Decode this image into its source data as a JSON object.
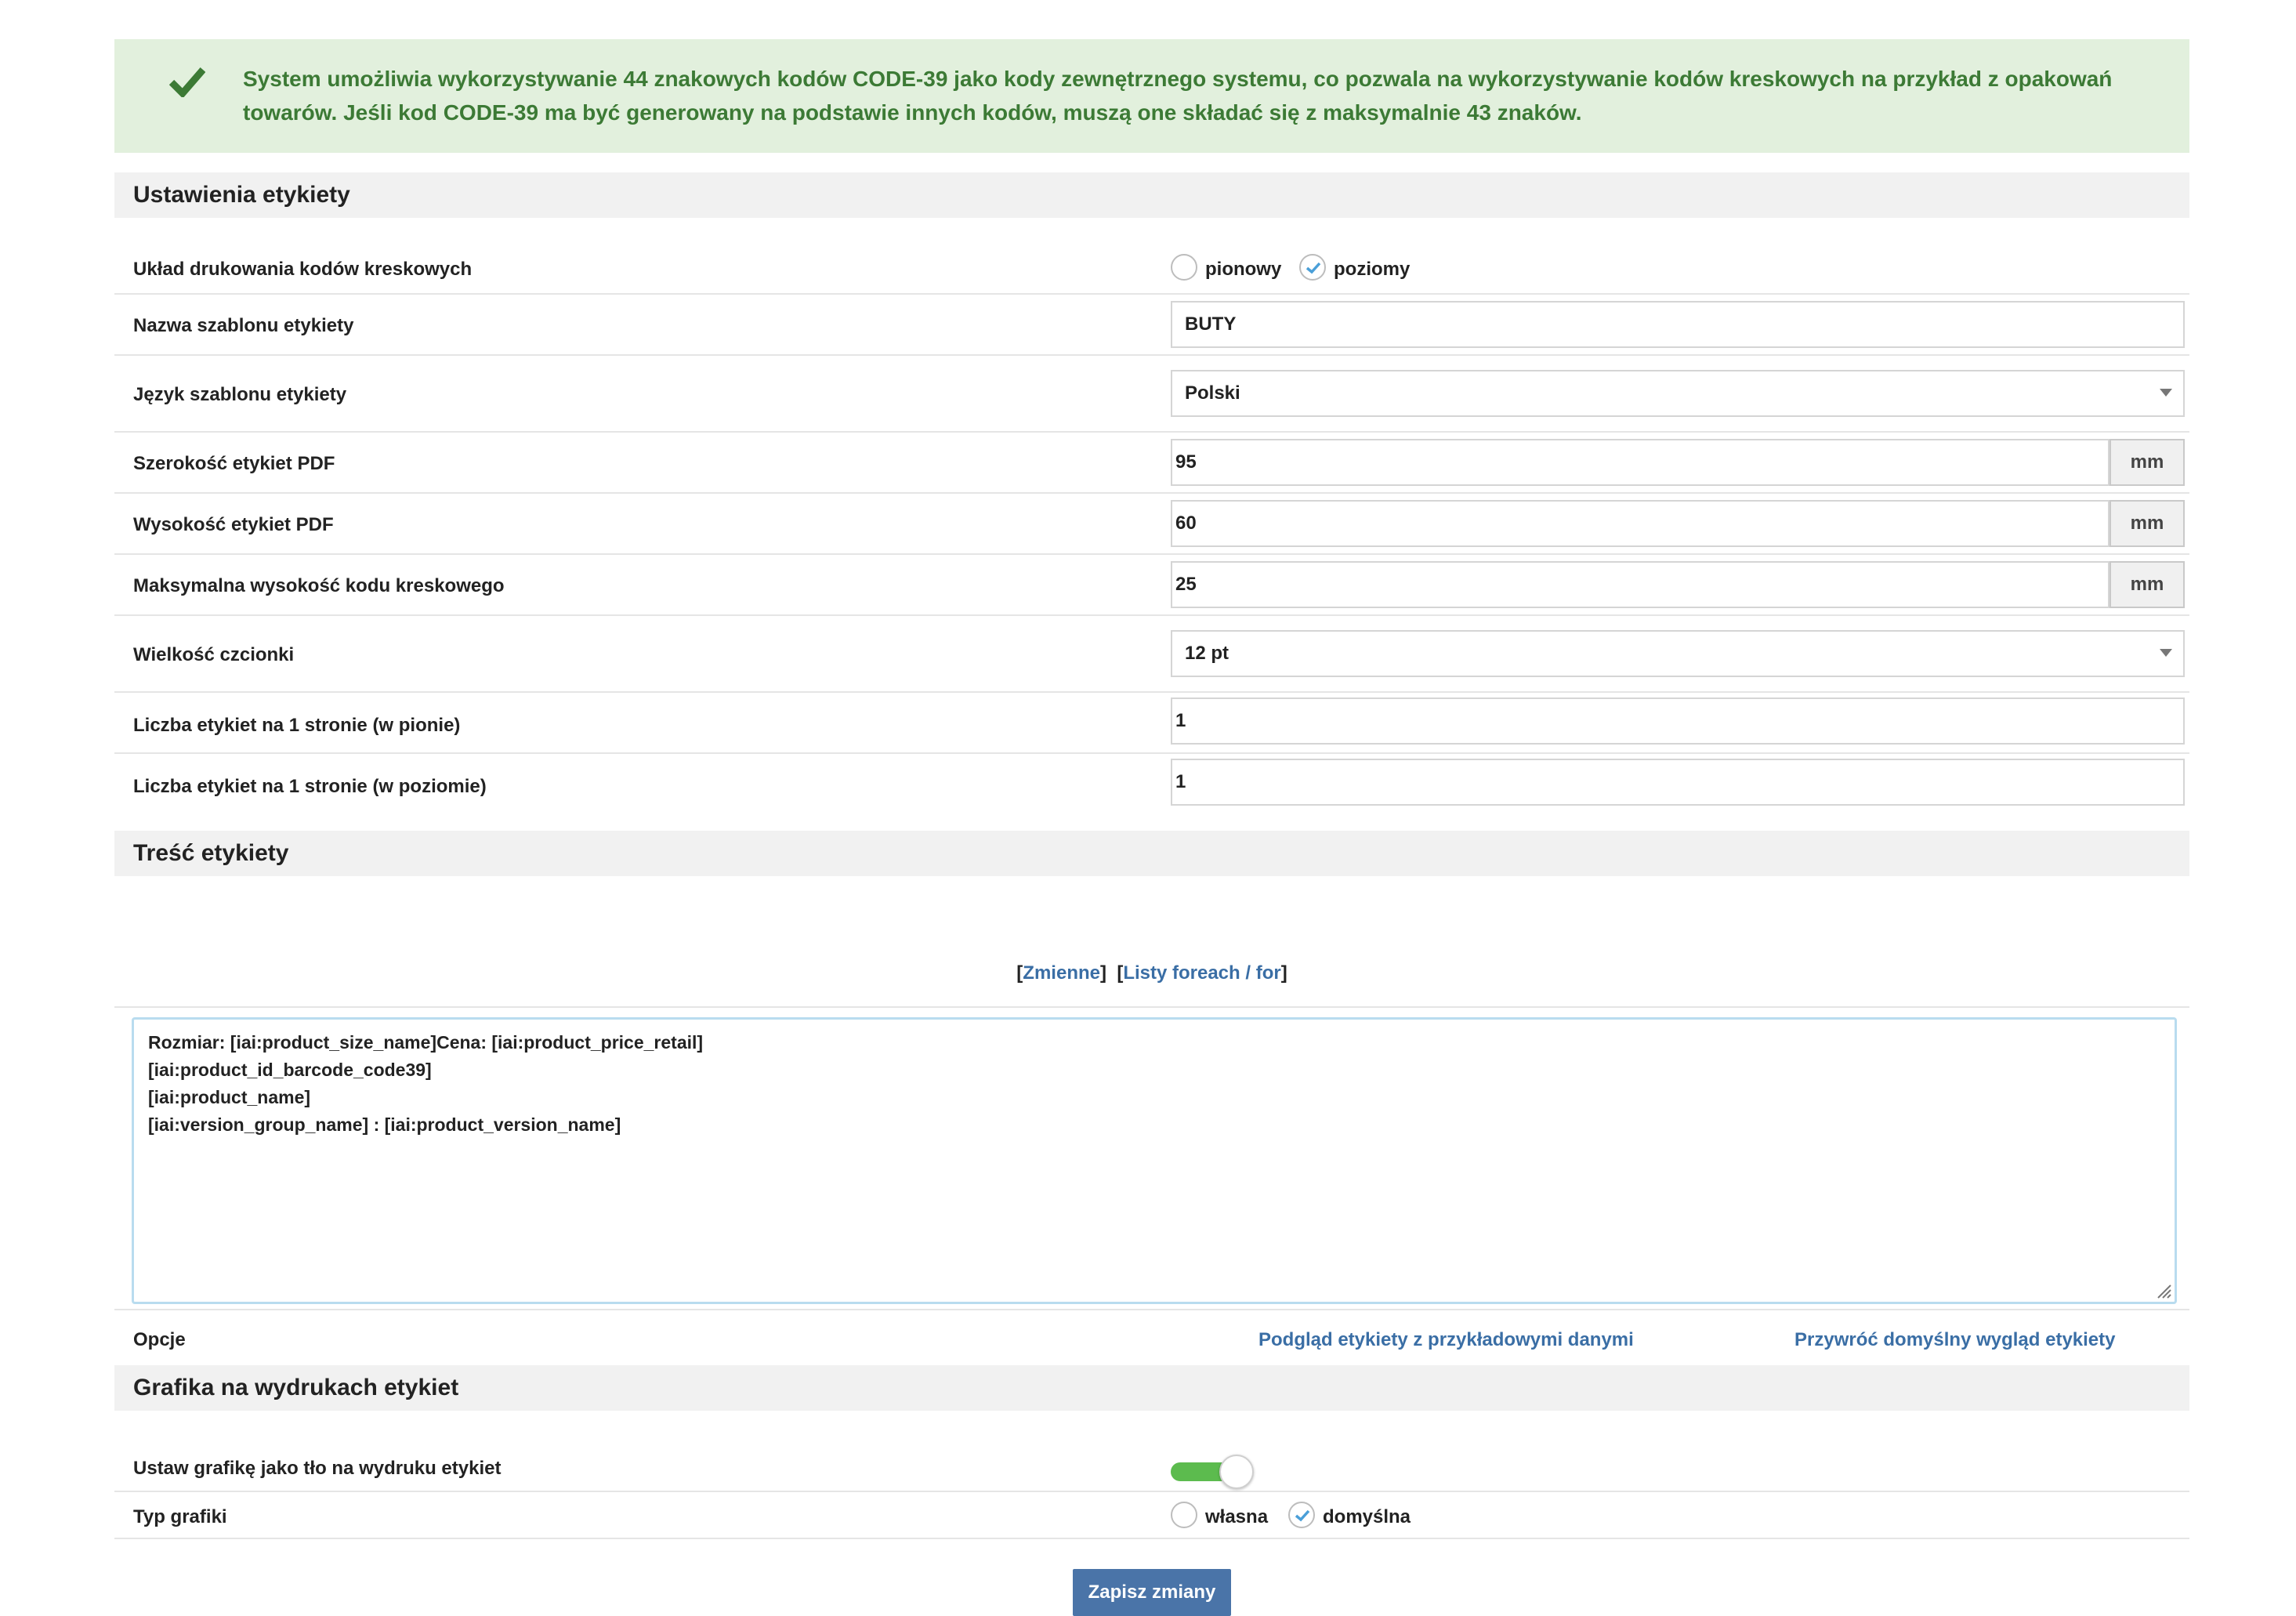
{
  "alert": {
    "text": "System umożliwia wykorzystywanie 44 znakowych kodów CODE-39 jako kody zewnętrznego systemu, co pozwala na wykorzystywanie kodów kreskowych na przykład z opakowań towarów. Jeśli kod CODE-39 ma być generowany na podstawie innych kodów, muszą one składać się z maksymalnie 43 znaków.",
    "color": "#3c7a35",
    "background": "#e2f0dd"
  },
  "settings": {
    "title": "Ustawienia etykiety",
    "layout": {
      "label": "Układ drukowania kodów kreskowych",
      "option_vertical": "pionowy",
      "option_horizontal": "poziomy",
      "selected": "poziomy"
    },
    "template_name": {
      "label": "Nazwa szablonu etykiety",
      "value": "BUTY"
    },
    "template_lang": {
      "label": "Język szablonu etykiety",
      "value": "Polski"
    },
    "pdf_width": {
      "label": "Szerokość etykiet PDF",
      "value": "95",
      "unit": "mm"
    },
    "pdf_height": {
      "label": "Wysokość etykiet PDF",
      "value": "60",
      "unit": "mm"
    },
    "barcode_height": {
      "label": "Maksymalna wysokość kodu kreskowego",
      "value": "25",
      "unit": "mm"
    },
    "font_size": {
      "label": "Wielkość czcionki",
      "value": "12 pt"
    },
    "per_page_vertical": {
      "label": "Liczba etykiet na 1 stronie (w pionie)",
      "value": "1"
    },
    "per_page_horizontal": {
      "label": "Liczba etykiet na 1 stronie (w poziomie)",
      "value": "1"
    }
  },
  "content": {
    "title": "Treść etykiety",
    "link_variables": "Zmienne",
    "link_loops": "Listy foreach / for",
    "textarea_lines": [
      "Rozmiar: [iai:product_size_name]Cena: [iai:product_price_retail]",
      "[iai:product_id_barcode_code39]",
      "[iai:product_name]",
      "[iai:version_group_name] : [iai:product_version_name]"
    ],
    "options_label": "Opcje",
    "preview_link": "Podgląd etykiety z przykładowymi danymi",
    "restore_link": "Przywróć domyślny wygląd etykiety"
  },
  "graphics": {
    "title": "Grafika na wydrukach etykiet",
    "background_toggle": {
      "label": "Ustaw grafikę jako tło na wydruku etykiet",
      "on": true
    },
    "type": {
      "label": "Typ grafiki",
      "option_own": "własna",
      "option_default": "domyślna",
      "selected": "domyślna"
    }
  },
  "save_button": "Zapisz zmiany",
  "colors": {
    "accent": "#3a6ea5",
    "button": "#4a74a8",
    "toggle_on": "#5cbb4e",
    "radio_check": "#4a9fd8"
  }
}
